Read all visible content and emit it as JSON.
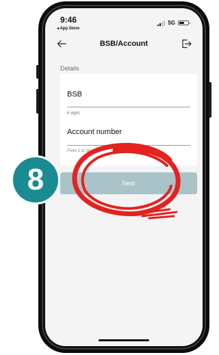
{
  "status_bar": {
    "time": "9:46",
    "back_label": "◂ App Store",
    "network": "5G"
  },
  "header": {
    "title": "BSB/Account"
  },
  "form": {
    "section_label": "Details",
    "bsb": {
      "label": "BSB",
      "hint": "6 digits"
    },
    "account": {
      "label": "Account number",
      "hint": "From 1 to 16"
    },
    "next_label": "Next"
  },
  "annotation": {
    "step_number": "8",
    "badge_color": "#1b8a93",
    "scribble_color": "#e4221f"
  },
  "colors": {
    "screen_bg": "#f4f4f5",
    "button_disabled": "#a9c3c9"
  },
  "icons": {
    "back": "arrow-left-icon",
    "exit": "logout-icon"
  }
}
